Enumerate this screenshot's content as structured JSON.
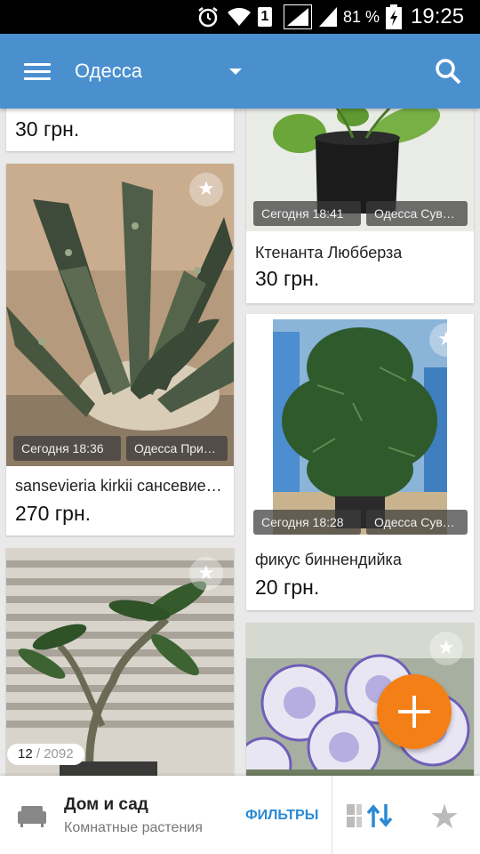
{
  "status_bar": {
    "battery_percent": "81 %",
    "time": "19:25",
    "sim_label": "1",
    "icons": [
      "alarm-icon",
      "wifi-icon",
      "sim-icon",
      "signal-icon",
      "signal-icon",
      "battery-charging-icon"
    ]
  },
  "app_bar": {
    "city": "Одесса",
    "icons": [
      "menu-icon",
      "dropdown-arrow-icon",
      "search-icon"
    ],
    "color": "#4a90cf"
  },
  "listings": [
    {
      "title": "",
      "price": "30 грн.",
      "date": "",
      "location": ""
    },
    {
      "title": "sansevieria kirkii сансевиерия",
      "price": "270 грн.",
      "date": "Сегодня 18:36",
      "location": "Одесса Приморский"
    },
    {
      "title": "",
      "price": "",
      "date": "",
      "location": ""
    },
    {
      "title": "Ктенанта Любберза",
      "price": "30 грн.",
      "date": "Сегодня 18:41",
      "location": "Одесса Суворовский"
    },
    {
      "title": "фикус биннендийка",
      "price": "20 грн.",
      "date": "Сегодня 18:28",
      "location": "Одесса Суворовский"
    },
    {
      "title": "",
      "price": "",
      "date": "",
      "location": ""
    }
  ],
  "counter": {
    "current": "12",
    "separator": " / ",
    "total": "2092"
  },
  "bottom_bar": {
    "category": "Дом и сад",
    "subcategory": "Комнатные растения",
    "filters_label": "ФИЛЬТРЫ",
    "icons": [
      "sofa-icon",
      "view-sort-icon",
      "star-icon"
    ]
  },
  "colors": {
    "accent": "#4a90cf",
    "fab": "#f57f17",
    "link": "#2a8ad4"
  }
}
